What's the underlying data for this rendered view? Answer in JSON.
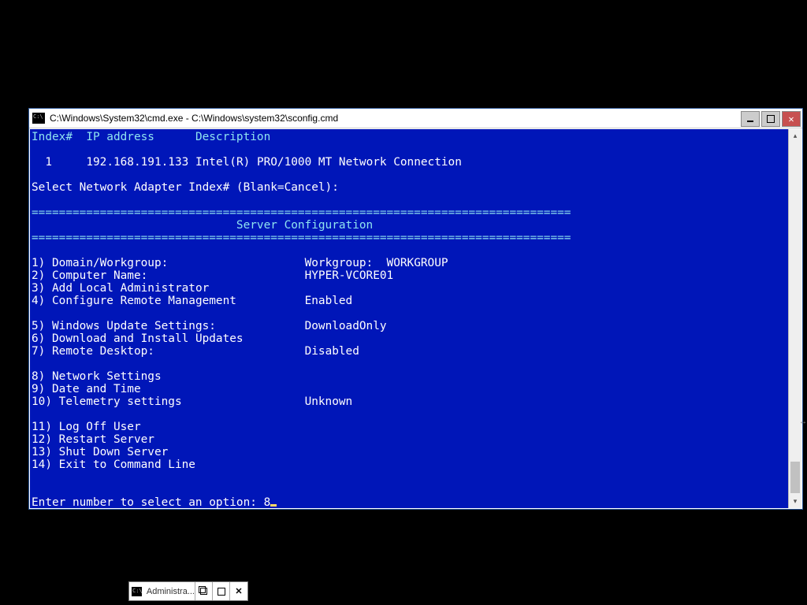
{
  "window": {
    "title": "C:\\Windows\\System32\\cmd.exe - C:\\Windows\\system32\\sconfig.cmd"
  },
  "net_header": {
    "col_index": "Index#",
    "col_ip": "IP address",
    "col_desc": "Description"
  },
  "net_row": {
    "index": "1",
    "ip": "192.168.191.133",
    "desc": "Intel(R) PRO/1000 MT Network Connection"
  },
  "select_adapter": "Select Network Adapter Index# (Blank=Cancel):",
  "rule": "===============================================================================",
  "config_title": "                              Server Configuration",
  "menu": {
    "1": {
      "label": "Domain/Workgroup:",
      "value": "Workgroup:  WORKGROUP"
    },
    "2": {
      "label": "Computer Name:",
      "value": "HYPER-VCORE01"
    },
    "3": {
      "label": "Add Local Administrator",
      "value": ""
    },
    "4": {
      "label": "Configure Remote Management",
      "value": "Enabled"
    },
    "5": {
      "label": "Windows Update Settings:",
      "value": "DownloadOnly"
    },
    "6": {
      "label": "Download and Install Updates",
      "value": ""
    },
    "7": {
      "label": "Remote Desktop:",
      "value": "Disabled"
    },
    "8": {
      "label": "Network Settings",
      "value": ""
    },
    "9": {
      "label": "Date and Time",
      "value": ""
    },
    "10": {
      "label": "Telemetry settings",
      "value": "Unknown"
    },
    "11": {
      "label": "Log Off User",
      "value": ""
    },
    "12": {
      "label": "Restart Server",
      "value": ""
    },
    "13": {
      "label": "Shut Down Server",
      "value": ""
    },
    "14": {
      "label": "Exit to Command Line",
      "value": ""
    }
  },
  "prompt": "Enter number to select an option: ",
  "input_value": "8",
  "taskbar_item": "Administra..."
}
